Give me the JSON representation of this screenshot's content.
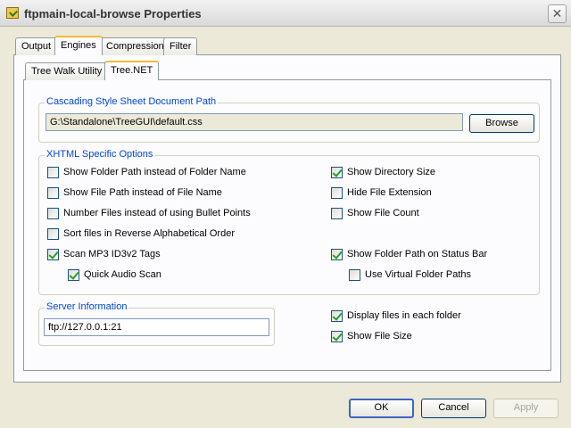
{
  "window": {
    "title": "ftpmain-local-browse Properties",
    "close_glyph": "✕"
  },
  "tabs": {
    "outer": [
      "Output",
      "Engines",
      "Compression",
      "Filter"
    ],
    "outer_active": "Engines",
    "inner": [
      "Tree Walk Utility",
      "Tree.NET"
    ],
    "inner_active": "Tree.NET"
  },
  "css_group": {
    "legend": "Cascading Style Sheet Document Path",
    "path_value": "G:\\Standalone\\TreeGUI\\default.css",
    "browse_label": "Browse"
  },
  "xhtml_group": {
    "legend": "XHTML Specific Options",
    "left_options": [
      {
        "label": "Show Folder Path instead of Folder Name",
        "checked": false
      },
      {
        "label": "Show File Path instead of File Name",
        "checked": false
      },
      {
        "label": "Number Files instead of using Bullet Points",
        "checked": false
      },
      {
        "label": "Sort files in Reverse Alphabetical Order",
        "checked": false
      },
      {
        "label": "Scan MP3 ID3v2 Tags",
        "checked": true
      },
      {
        "label": "Quick Audio Scan",
        "checked": true
      }
    ],
    "right_options": [
      {
        "label": "Show Directory Size",
        "checked": true
      },
      {
        "label": "Hide File Extension",
        "checked": false
      },
      {
        "label": "Show File Count",
        "checked": false
      },
      {
        "label": "Show Folder Path on Status Bar",
        "checked": true
      },
      {
        "label": "Use Virtual Folder Paths",
        "checked": false
      }
    ]
  },
  "server_group": {
    "legend": "Server Information",
    "server_value": "ftp://127.0.0.1:21"
  },
  "bottom_options": [
    {
      "label": "Display files in each folder",
      "checked": true
    },
    {
      "label": "Show File Size",
      "checked": true
    }
  ],
  "footer": {
    "ok_label": "OK",
    "cancel_label": "Cancel",
    "apply_label": "Apply"
  },
  "colors": {
    "window_bg": "#ece9d8",
    "legend_text": "#0046d5",
    "checkmark": "#21a121",
    "active_tab_accent": "#f6b93a"
  },
  "icons": [
    "app-icon",
    "close-icon",
    "checkbox-icon"
  ]
}
